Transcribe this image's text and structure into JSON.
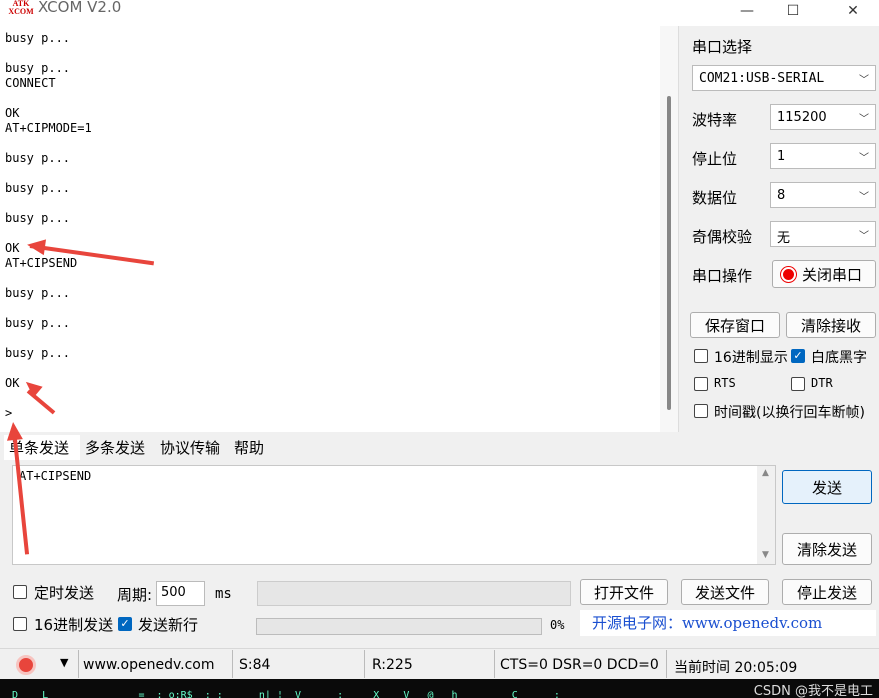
{
  "window": {
    "title": "XCOM V2.0",
    "logo": "ATK\nXCOM",
    "controls": {
      "minimize": "—",
      "maximize": "☐",
      "close": "✕"
    }
  },
  "receive": {
    "lines": [
      "busy p...",
      "",
      "busy p...",
      "CONNECT",
      "",
      "OK",
      "AT+CIPMODE=1",
      "",
      "busy p...",
      "",
      "busy p...",
      "",
      "busy p...",
      "",
      "OK",
      "AT+CIPSEND",
      "",
      "busy p...",
      "",
      "busy p...",
      "",
      "busy p...",
      "",
      "OK",
      "",
      ">"
    ]
  },
  "port": {
    "label": "串口选择",
    "value": "COM21:USB-SERIAL"
  },
  "baud": {
    "label": "波特率",
    "value": "115200"
  },
  "stopbits": {
    "label": "停止位",
    "value": "1"
  },
  "databits": {
    "label": "数据位",
    "value": "8"
  },
  "parity": {
    "label": "奇偶校验",
    "value": "无"
  },
  "portop": {
    "label": "串口操作",
    "button": "关闭串口"
  },
  "buttons": {
    "save_window": "保存窗口",
    "clear_receive": "清除接收",
    "send": "发送",
    "clear_send": "清除发送",
    "open_file": "打开文件",
    "send_file": "发送文件",
    "stop_send": "停止发送"
  },
  "options": {
    "hex_display": "16进制显示",
    "white_bg": "白底黑字",
    "rts": "RTS",
    "dtr": "DTR",
    "timestamp": "时间戳(以换行回车断帧)",
    "timed_send": "定时发送",
    "period_label": "周期:",
    "period_value": "500",
    "period_unit": "ms",
    "hex_send": "16进制发送",
    "newline": "发送新行"
  },
  "tabs": [
    "单条发送",
    "多条发送",
    "协议传输",
    "帮助"
  ],
  "send_text": "AT+CIPSEND",
  "brand": "开源电子网：www.openedv.com",
  "progress": {
    "text": "0%",
    "value": 0
  },
  "status": {
    "url": "www.openedv.com",
    "sent": "S:84",
    "received": "R:225",
    "lines": "CTS=0 DSR=0 DCD=0",
    "time": "当前时间 20:05:09"
  },
  "taskbar": {
    "text": "D    L               =  : o:R$  ; :      n| ¦  V      ;     X    V   @   h         C      ;",
    "watermark": "CSDN @我不是电工"
  },
  "colors": {
    "accent": "#0067c0",
    "arrow": "#e8453c",
    "brand": "#1a4fd0"
  }
}
